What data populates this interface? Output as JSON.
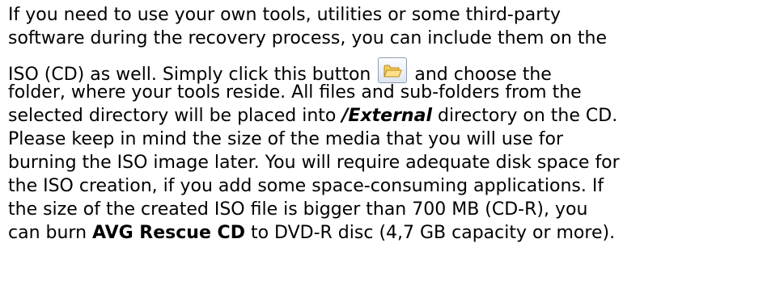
{
  "paragraph": {
    "line1": "If you need to use your own tools, utilities or some third-party",
    "line2": "software during the recovery process, you can include them on the",
    "line3_before_button": "ISO (CD) as well. Simply click this button",
    "line3_after_button": "and choose the",
    "line4": "folder, where your tools reside. All files and sub-folders from the",
    "line5_before": "selected directory will be placed into",
    "line5_emphasis": "/External",
    "line5_after": "directory on the CD.",
    "line6": "Please keep in mind the size of the media that you will use for",
    "line7": "burning the ISO image later. You will require adequate disk space for",
    "line8": "the ISO creation, if you add some space-consuming applications. If",
    "line9": "the size of the created ISO file is bigger than 700 MB (CD-R), you",
    "line10_before": "can burn",
    "line10_emphasis": "AVG Rescue CD",
    "line10_after": "to DVD-R disc (4,7 GB capacity or more)."
  },
  "folder_button": {
    "icon": "folder-open-icon",
    "colors": {
      "folder_fill": "#f3cc5a",
      "folder_stroke": "#b68a1c"
    }
  }
}
